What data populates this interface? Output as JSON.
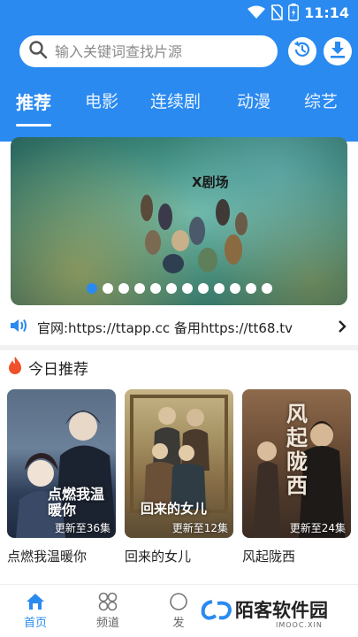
{
  "status_bar": {
    "time": "11:14"
  },
  "search": {
    "placeholder": "输入关键词查找片源"
  },
  "tabs": [
    {
      "label": "推荐"
    },
    {
      "label": "电影"
    },
    {
      "label": "连续剧"
    },
    {
      "label": "动漫"
    },
    {
      "label": "综艺"
    }
  ],
  "banner": {
    "logo_text": "X剧场",
    "dot_count": 12,
    "active_dot": 0
  },
  "notice": {
    "text": "官网:https://ttapp.cc 备用https://tt68.tv"
  },
  "section": {
    "title": "今日推荐"
  },
  "cards": [
    {
      "title": "点燃我温暖你",
      "update": "更新至36集",
      "poster_text": "点燃我温暖你"
    },
    {
      "title": "回来的女儿",
      "update": "更新至12集",
      "poster_text": "回来的女儿"
    },
    {
      "title": "风起陇西",
      "update": "更新至24集",
      "poster_text": "风起陇西"
    }
  ],
  "bottom_nav": [
    {
      "label": "首页"
    },
    {
      "label": "频道"
    },
    {
      "label": "发"
    }
  ],
  "watermark": {
    "text": "陌客软件园",
    "sub": "IMOOC.XIN"
  },
  "colors": {
    "accent": "#2a8af0",
    "fire": "#f0502a"
  },
  "icons": [
    "wifi-icon",
    "no-sim-icon",
    "battery-icon",
    "search-icon",
    "history-icon",
    "download-icon",
    "speaker-icon",
    "chevron-right-icon",
    "fire-icon",
    "home-icon",
    "channel-icon"
  ]
}
